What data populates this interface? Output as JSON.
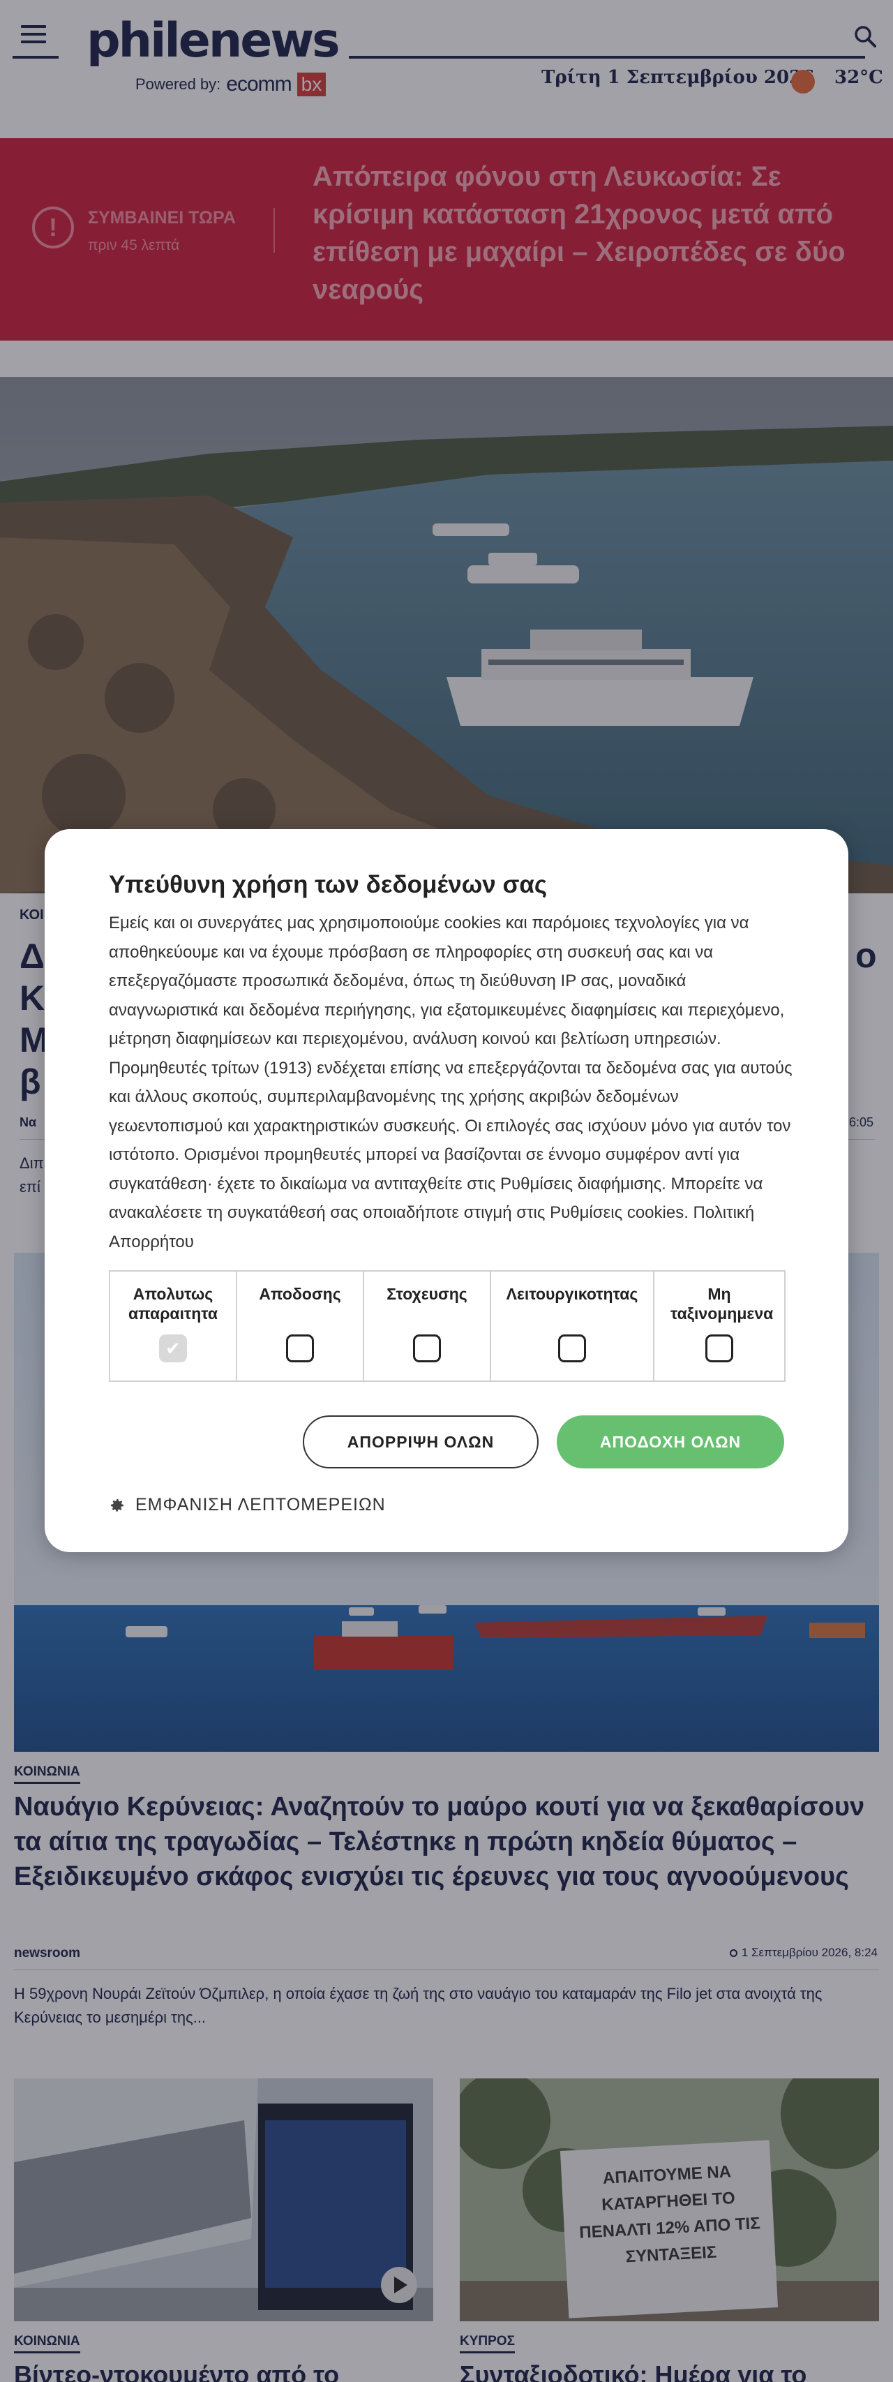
{
  "header": {
    "logo": "philenews",
    "powered_label": "Powered by:",
    "powered_brand": "ecomm",
    "powered_brand_box": "bx",
    "date": "Τρίτη 1 Σεπτεμβρίου 2026",
    "temperature": "32°C",
    "icons": [
      "hamburger-icon",
      "search-icon",
      "weather-icon"
    ]
  },
  "breaking": {
    "label": "ΣΥΜΒΑΙΝΕΙ ΤΩΡΑ",
    "time": "πριν 45 λεπτά",
    "title": "Απόπειρα φόνου στη Λευκωσία: Σε κρίσιμη κατάσταση 21χρονος μετά από επίθεση με μαχαίρι – Χειροπέδες σε δύο νεαρούς"
  },
  "hero": {
    "category": "ΚΟΙ",
    "title_lines": [
      "Δ",
      "Κ",
      "Μ",
      "β"
    ],
    "title_tail": "ο",
    "author": "Να",
    "date": "6:05",
    "excerpt_lines": [
      "Διπ",
      "επί"
    ]
  },
  "article2": {
    "category": "ΚΟΙΝΩΝΙΑ",
    "title": "Ναυάγιο Κερύνειας: Αναζητούν το μαύρο κουτί για να ξεκαθαρίσουν τα αίτια της τραγωδίας – Τελέστηκε η πρώτη κηδεία θύματος – Εξειδικευμένο σκάφος ενισχύει τις έρευνες για τους αγνοούμενους",
    "author": "newsroom",
    "date": "1 Σεπτεμβρίου 2026, 8:24",
    "excerpt": "Η 59χρονη Νουράι Ζεϊτούν Όζμπιλερ, η οποία έχασε τη ζωή της στο ναυάγιο του καταμαράν της Filo jet στα ανοιχτά της Κερύνειας το μεσημέρι της..."
  },
  "cards": [
    {
      "category": "ΚΟΙΝΩΝΙΑ",
      "title": "Βίντεο-ντοκουμέντο από το"
    },
    {
      "category": "ΚΥΠΡΟΣ",
      "title": "Συνταξιοδοτικό: Ημέρα για το",
      "sign": "ΑΠΑΙΤΟΥΜΕ ΝΑ ΚΑΤΑΡΓΗΘΕΙ ΤΟ ΠΕΝΑΛΤΙ 12% ΑΠΟ ΤΙΣ ΣΥΝΤΑΞΕΙΣ"
    }
  ],
  "consent": {
    "title": "Υπεύθυνη χρήση των δεδομένων σας",
    "text": "Εμείς και οι συνεργάτες μας χρησιμοποιούμε cookies και παρόμοιες τεχνολογίες για να αποθηκεύουμε και να έχουμε πρόσβαση σε πληροφορίες στη συσκευή σας και να επεξεργαζόμαστε προσωπικά δεδομένα, όπως τη διεύθυνση IP σας, μοναδικά αναγνωριστικά και δεδομένα περιήγησης, για εξατομικευμένες διαφημίσεις και περιεχόμενο, μέτρηση διαφημίσεων και περιεχομένου, ανάλυση κοινού και βελτίωση υπηρεσιών. Προμηθευτές τρίτων (1913) ενδέχεται επίσης να επεξεργάζονται τα δεδομένα σας για αυτούς και άλλους σκοπούς, συμπεριλαμβανομένης της χρήσης ακριβών δεδομένων γεωεντοπισμού και χαρακτηριστικών συσκευής. Οι επιλογές σας ισχύουν μόνο για αυτόν τον ιστότοπο. Ορισμένοι προμηθευτές μπορεί να βασίζονται σε έννομο συμφέρον αντί για συγκατάθεση· έχετε το δικαίωμα να αντιταχθείτε στις Ρυθμίσεις διαφήμισης. Μπορείτε να ανακαλέσετε τη συγκατάθεσή σας οποιαδήποτε στιγμή στις Ρυθμίσεις cookies. Πολιτική Απορρήτου",
    "categories": [
      {
        "label": "Απολυτως απαραιτητα",
        "checked": true
      },
      {
        "label": "Αποδοσης",
        "checked": false
      },
      {
        "label": "Στοχευσης",
        "checked": false
      },
      {
        "label": "Λειτουργικοτητας",
        "checked": false
      },
      {
        "label": "Μη ταξινομημενα",
        "checked": false
      }
    ],
    "reject_label": "ΑΠΟΡΡΙΨΗ ΟΛΩΝ",
    "accept_label": "ΑΠΟΔΟΧΗ ΟΛΩΝ",
    "details_label": "ΕΜΦΑΝΙΣΗ ΛΕΠΤΟΜΕΡΕΙΩΝ",
    "accept_color": "#67c070"
  }
}
